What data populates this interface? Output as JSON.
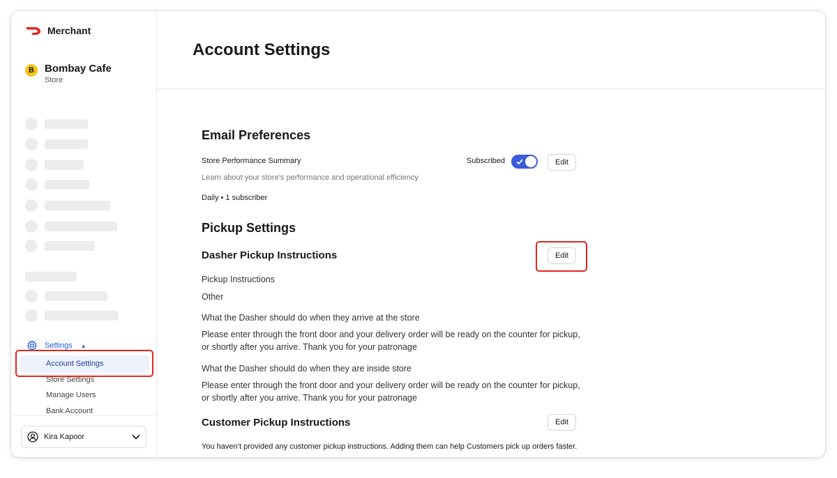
{
  "brand": {
    "name": "Merchant",
    "color": "#e3261d"
  },
  "store": {
    "initial": "B",
    "name": "Bombay Cafe",
    "type": "Store"
  },
  "sidebar": {
    "settings_label": "Settings",
    "sub_items": [
      {
        "label": "Account Settings",
        "active": true
      },
      {
        "label": "Store Settings"
      },
      {
        "label": "Manage Users"
      },
      {
        "label": "Bank Account"
      }
    ]
  },
  "user": {
    "name": "Kira Kapoor"
  },
  "page": {
    "title": "Account Settings"
  },
  "email_prefs": {
    "heading": "Email Preferences",
    "item_title": "Store Performance Summary",
    "item_desc": "Learn about your store’s performance and operational efficiency",
    "frequency": "Daily • 1 subscriber",
    "status": "Subscribed",
    "subscribed": true,
    "edit_label": "Edit"
  },
  "pickup": {
    "heading": "Pickup Settings",
    "dasher": {
      "heading": "Dasher Pickup Instructions",
      "edit_label": "Edit",
      "instructions_label": "Pickup Instructions",
      "instructions_value": "Other",
      "arrive_label": "What the Dasher should do when they arrive at the store",
      "arrive_text": "Please enter through the front door and your delivery order will be ready on the counter for pickup, or shortly after you arrive. Thank you for your patronage",
      "inside_label": "What the Dasher should do when they are inside store",
      "inside_text": "Please enter through the front door and your delivery order will be ready on the counter for pickup, or shortly after you arrive. Thank you for your patronage"
    },
    "customer": {
      "heading": "Customer Pickup Instructions",
      "edit_label": "Edit",
      "empty_text": "You haven’t provided any customer pickup instructions. Adding them can help Customers pick up orders faster."
    }
  },
  "colors": {
    "accent": "#3b5bdb",
    "link": "#1a5bd8",
    "highlight": "#e3261d"
  }
}
